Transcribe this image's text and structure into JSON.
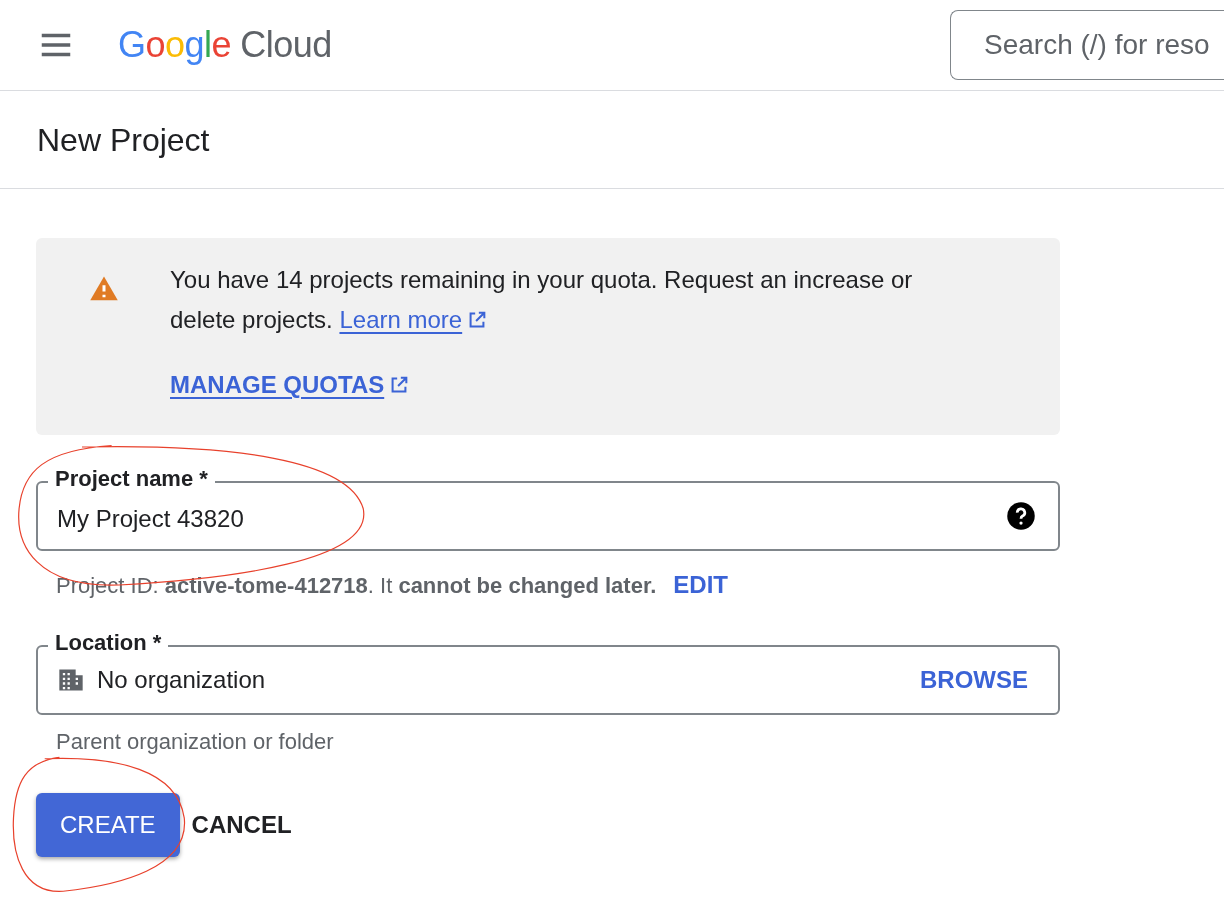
{
  "header": {
    "brand": "Google",
    "product": "Cloud",
    "search": {
      "placeholder": "Search (/) for reso"
    }
  },
  "page_title": "New Project",
  "notice": {
    "text": "You have 14 projects remaining in your quota. Request an increase or delete projects.",
    "link": "Learn more",
    "action": "MANAGE QUOTAS"
  },
  "project_name": {
    "label": "Project name *",
    "value": "My Project 43820",
    "circled": true,
    "hint": "Project ID: **active-tome-412718**. It **cannot be changed later.**",
    "hint_action": "EDIT"
  },
  "location": {
    "label": "Location *",
    "value": "No organization",
    "action": "BROWSE",
    "hint": "Parent organization or folder"
  },
  "buttons": [
    {
      "label": "CREATE",
      "kind": "primary",
      "circled": true
    },
    {
      "label": "CANCEL",
      "kind": "text",
      "circled": false
    }
  ]
}
